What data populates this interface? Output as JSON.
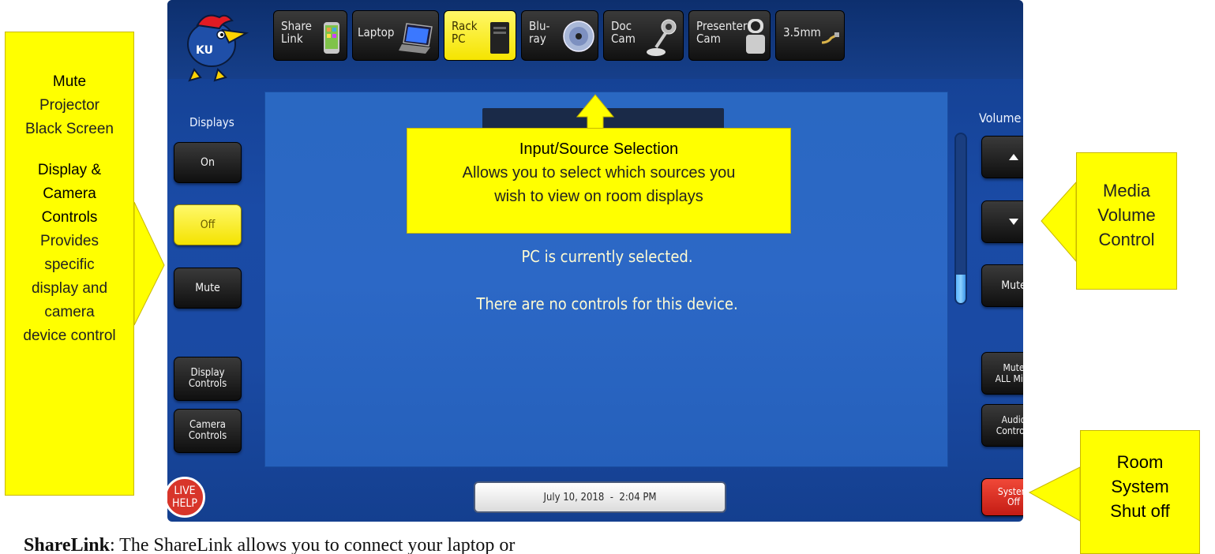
{
  "sources": [
    {
      "label": "Share\nLink",
      "icon": "phone-icon"
    },
    {
      "label": "Laptop",
      "icon": "laptop-icon"
    },
    {
      "label": "Rack\nPC",
      "icon": "rack-pc-icon",
      "selected": true
    },
    {
      "label": "Blu-\nray",
      "icon": "disc-icon"
    },
    {
      "label": "Doc\nCam",
      "icon": "doc-camera-icon"
    },
    {
      "label": "Presenter\nCam",
      "icon": "ptz-camera-icon"
    },
    {
      "label": "3.5mm",
      "icon": "audio-cable-icon"
    }
  ],
  "left": {
    "displays_label": "Displays",
    "on": "On",
    "off": "Off",
    "mute": "Mute",
    "display_controls": "Display\nControls",
    "camera_controls": "Camera\nControls",
    "live_help": "LIVE\nHELP"
  },
  "right": {
    "volume_label": "Volume",
    "mute": "Mute",
    "mute_all_mics": "Mute\nALL Mics",
    "audio_controls": "Audio\nControls",
    "system_off": "System\nOff",
    "volume_level_percent": 17
  },
  "screen": {
    "msg1": "PC is currently selected.",
    "msg2": "There are no controls for this device."
  },
  "datetime": "July 10, 2018  -  2:04 PM",
  "callouts": {
    "left_title1": "Mute",
    "left_body1": "Projector Black Screen",
    "left_title2": "Display & Camera Controls",
    "left_body2": "Provides specific display and camera device control",
    "input_title": "Input/Source Selection",
    "input_body": "Allows you to select which sources you wish to view on room displays",
    "media": "Media Volume Control",
    "room": "Room System Shut off"
  },
  "caption": {
    "bold": "ShareLink",
    "rest": ": The ShareLink allows you to connect your laptop or"
  },
  "colors": {
    "callout": "#ffff00",
    "panel_blue": "#1a4aa3",
    "screen_blue": "#2c68c6",
    "selected": "#f5e400",
    "system_off": "#d8352a"
  }
}
